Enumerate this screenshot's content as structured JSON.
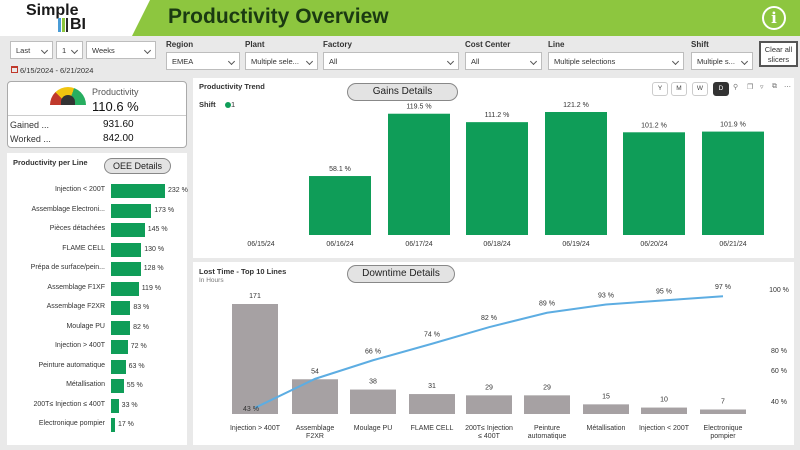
{
  "header": {
    "logo_top": "Simple",
    "logo_bottom": "BI",
    "title": "Productivity Overview",
    "info_icon": "i"
  },
  "slicers": {
    "period_mode": "Last",
    "period_count": "1",
    "period_unit": "Weeks",
    "date_range": "6/15/2024 - 6/21/2024",
    "region_label": "Region",
    "region_value": "EMEA",
    "plant_label": "Plant",
    "plant_value": "Multiple sele...",
    "factory_label": "Factory",
    "factory_value": "All",
    "cost_center_label": "Cost Center",
    "cost_center_value": "All",
    "line_label": "Line",
    "line_value": "Multiple selections",
    "shift_label": "Shift",
    "shift_value": "Multiple s...",
    "clear_label": "Clear all slicers"
  },
  "kpi": {
    "title": "Productivity",
    "value": "110.6 %",
    "gained_label": "Gained ...",
    "gained_value": "931.60",
    "worked_label": "Worked ...",
    "worked_value": "842.00",
    "icon": "gauge-icon"
  },
  "productivity_per_line": {
    "title": "Productivity per Line",
    "button": "OEE Details"
  },
  "trend": {
    "title": "Productivity Trend",
    "button": "Gains Details",
    "legend_title": "Shift",
    "legend_item": "1",
    "period_buttons": [
      "Y",
      "M",
      "W",
      "D"
    ],
    "active_period": "D"
  },
  "lost_time": {
    "title": "Lost Time - Top 10 Lines",
    "subtitle": "In Hours",
    "button": "Downtime Details"
  },
  "colors": {
    "header_green": "#8dc63f",
    "bar_green": "#0f9d58",
    "bar_grey": "#a6a1a3",
    "pareto_line": "#5dade2"
  },
  "chart_data": [
    {
      "type": "bar",
      "orientation": "horizontal",
      "categories": [
        "Injection < 200T",
        "Assemblage Electroni...",
        "Pièces détachées",
        "FLAME CELL",
        "Prépa de surface/pein...",
        "Assemblage F1XF",
        "Assemblage F2XR",
        "Moulage PU",
        "Injection > 400T",
        "Peinture automatique",
        "Métallisation",
        "200T≤ Injection ≤ 400T",
        "Electronique pompier"
      ],
      "values": [
        232,
        173,
        145,
        130,
        128,
        119,
        83,
        82,
        72,
        63,
        55,
        33,
        17
      ],
      "value_labels": [
        "232 %",
        "173 %",
        "145 %",
        "130 %",
        "128 %",
        "119 %",
        "83 %",
        "82 %",
        "72 %",
        "63 %",
        "55 %",
        "33 %",
        "17 %"
      ],
      "color": "#0f9d58"
    },
    {
      "type": "bar",
      "categories": [
        "06/15/24",
        "06/16/24",
        "06/17/24",
        "06/18/24",
        "06/19/24",
        "06/20/24",
        "06/21/24"
      ],
      "values": [
        null,
        58.1,
        119.5,
        111.2,
        121.2,
        101.2,
        101.9
      ],
      "value_labels": [
        "",
        "58.1 %",
        "119.5 %",
        "111.2 %",
        "121.2 %",
        "101.2 %",
        "101.9 %"
      ],
      "series_name": "1",
      "color": "#0f9d58"
    },
    {
      "type": "bar",
      "categories": [
        "Injection > 400T",
        "Assemblage F2XR",
        "Moulage PU",
        "FLAME CELL",
        "200T≤ Injection ≤ 400T",
        "Peinture automatique",
        "Métallisation",
        "Injection < 200T",
        "Electronique pompier"
      ],
      "category_lines": [
        [
          "Injection > 400T"
        ],
        [
          "Assemblage",
          "F2XR"
        ],
        [
          "Moulage PU"
        ],
        [
          "FLAME CELL"
        ],
        [
          "200T≤ Injection",
          "≤ 400T"
        ],
        [
          "Peinture",
          "automatique"
        ],
        [
          "Métallisation"
        ],
        [
          "Injection < 200T"
        ],
        [
          "Electronique",
          "pompier"
        ]
      ],
      "values": [
        171,
        54,
        38,
        31,
        29,
        29,
        15,
        10,
        7
      ],
      "cumulative_pct": [
        43,
        57,
        66,
        74,
        82,
        89,
        93,
        95,
        97
      ],
      "cumulative_labels": [
        "43 %",
        "",
        "66 %",
        "74 %",
        "82 %",
        "89 %",
        "93 %",
        "95 %",
        "97 %"
      ],
      "y2_ticks": [
        "100 %",
        "80 %",
        "60 %",
        "40 %"
      ],
      "y2_range": [
        40,
        100
      ],
      "bar_color": "#a6a1a3",
      "line_color": "#5dade2"
    }
  ]
}
